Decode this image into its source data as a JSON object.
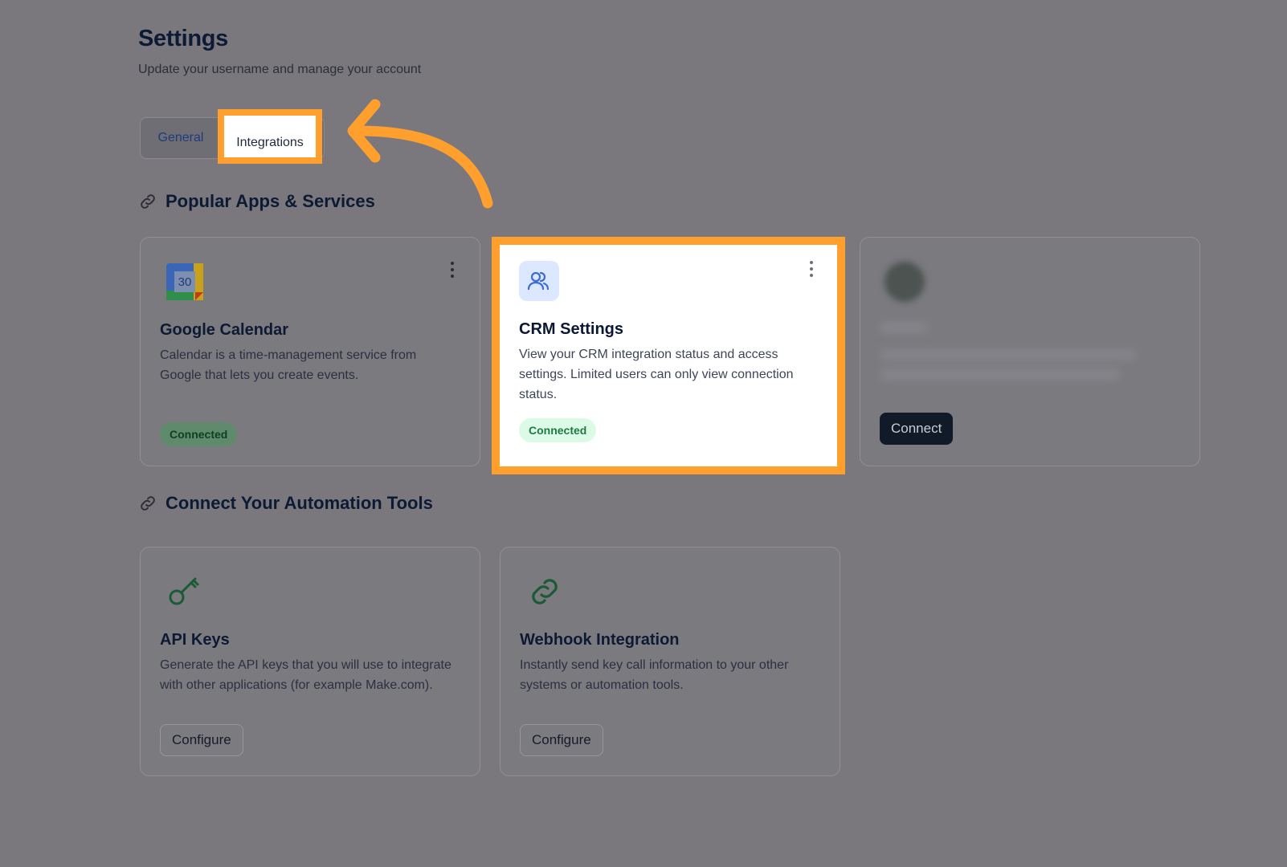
{
  "page": {
    "title": "Settings",
    "subtitle": "Update your username and manage your account"
  },
  "tabs": {
    "general": "General",
    "integrations": "Integrations"
  },
  "popular": {
    "heading": "Popular Apps & Services",
    "cards": [
      {
        "name": "Google Calendar",
        "description": "Calendar is a time-management service from Google that lets you create events.",
        "status": "Connected",
        "calendar_day": "30"
      },
      {
        "name": "CRM Settings",
        "description": "View your CRM integration status and access settings. Limited users can only view connection status.",
        "status": "Connected"
      },
      {
        "action": "Connect"
      }
    ]
  },
  "automation": {
    "heading": "Connect Your Automation Tools",
    "cards": [
      {
        "name": "API Keys",
        "description": "Generate the API keys that you will use to integrate with other applications (for example Make.com).",
        "action": "Configure"
      },
      {
        "name": "Webhook Integration",
        "description": "Instantly send key call information to your other systems or automation tools.",
        "action": "Configure"
      }
    ]
  },
  "colors": {
    "highlight": "#ff9f2e",
    "overlay": "#7a787d"
  }
}
